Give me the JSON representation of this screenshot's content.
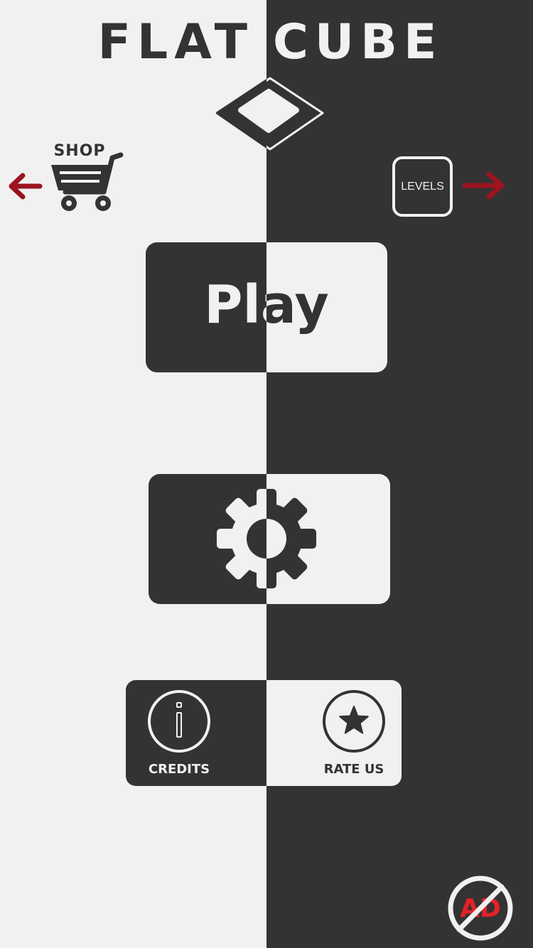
{
  "title": {
    "left": "FLAT",
    "right": "CUBE"
  },
  "shop": {
    "label": "SHOP"
  },
  "levels": {
    "label": "LEVELS"
  },
  "play": {
    "label": "Play"
  },
  "footer": {
    "credits_label": "CREDITS",
    "rate_label": "RATE US"
  },
  "no_ads": {
    "text": "AD"
  },
  "icons": {
    "logo": "cube-logo-icon",
    "shop": "shopping-cart-icon",
    "shop_arrow": "arrow-left-icon",
    "levels_arrow": "arrow-right-icon",
    "settings": "gear-icon",
    "credits": "info-icon",
    "rate": "star-icon",
    "no_ads": "no-ads-icon"
  },
  "colors": {
    "light": "#f1f1f1",
    "dark": "#333333",
    "arrow": "#9b1420",
    "no_ads_red": "#e62129"
  }
}
